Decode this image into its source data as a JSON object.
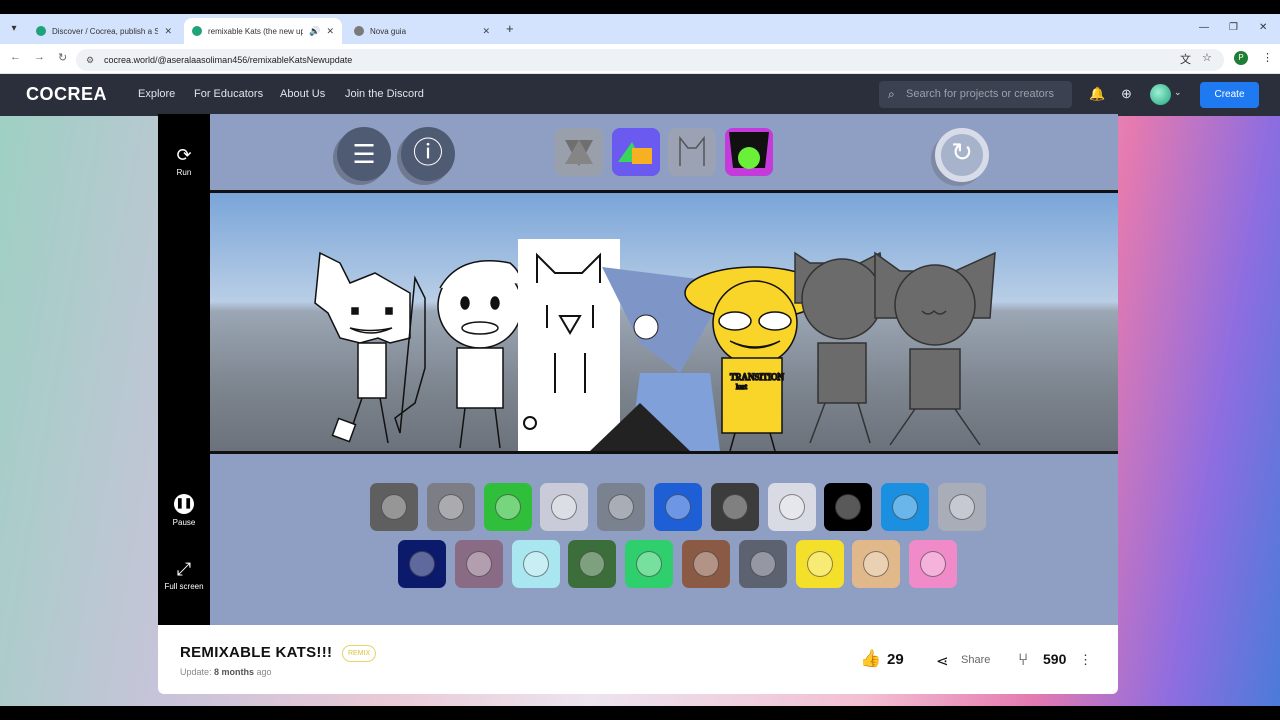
{
  "browser": {
    "tabs": [
      {
        "title": "Discover / Cocrea, publish a Sc",
        "active": false,
        "favicon_color": "#1ea37a"
      },
      {
        "title": "remixable Kats (the new up",
        "active": true,
        "favicon_color": "#1ea37a",
        "audio": true
      },
      {
        "title": "Nova guia",
        "active": false,
        "favicon_color": "#7a7a7a"
      }
    ],
    "url": "cocrea.world/@aseralaasoliman456/remixableKatsNewupdate",
    "profile_initial": "P"
  },
  "site": {
    "logo": "COCREA",
    "nav": [
      "Explore",
      "For Educators",
      "About Us",
      "Join the Discord"
    ],
    "search_placeholder": "Search for projects or creators",
    "create_label": "Create"
  },
  "player": {
    "run_label": "Run",
    "pause_label": "Pause",
    "fullscreen_label": "Full screen"
  },
  "project": {
    "title": "REMIXABLE KATS!!!",
    "badge": "REMIX",
    "update_prefix": "Update: ",
    "update_value": "8 months",
    "update_suffix": " ago",
    "likes": "29",
    "share_label": "Share",
    "remixes": "590"
  },
  "game": {
    "shirt_text": "TRANSITION",
    "shirt_sub": "kart",
    "palette_row1": [
      "#5f5f5f",
      "#7d7d85",
      "#2fbf3a",
      "#c9ccd8",
      "#7a828f",
      "#1f5fd6",
      "#3c3c3c",
      "#d8dbe3",
      "#000000",
      "#1b8fe0",
      "#a8adb8"
    ],
    "palette_row2": [
      "#0b1a6b",
      "#8a6b86",
      "#a9e6ef",
      "#3b6e3b",
      "#2ecf6c",
      "#8a5a44",
      "#5c6270",
      "#f4e02a",
      "#e0b88a",
      "#f08ac9"
    ]
  },
  "colors": {
    "accent": "#1f7af2",
    "header_bg": "#2a2f3b",
    "game_bg": "#8f9fc4"
  }
}
